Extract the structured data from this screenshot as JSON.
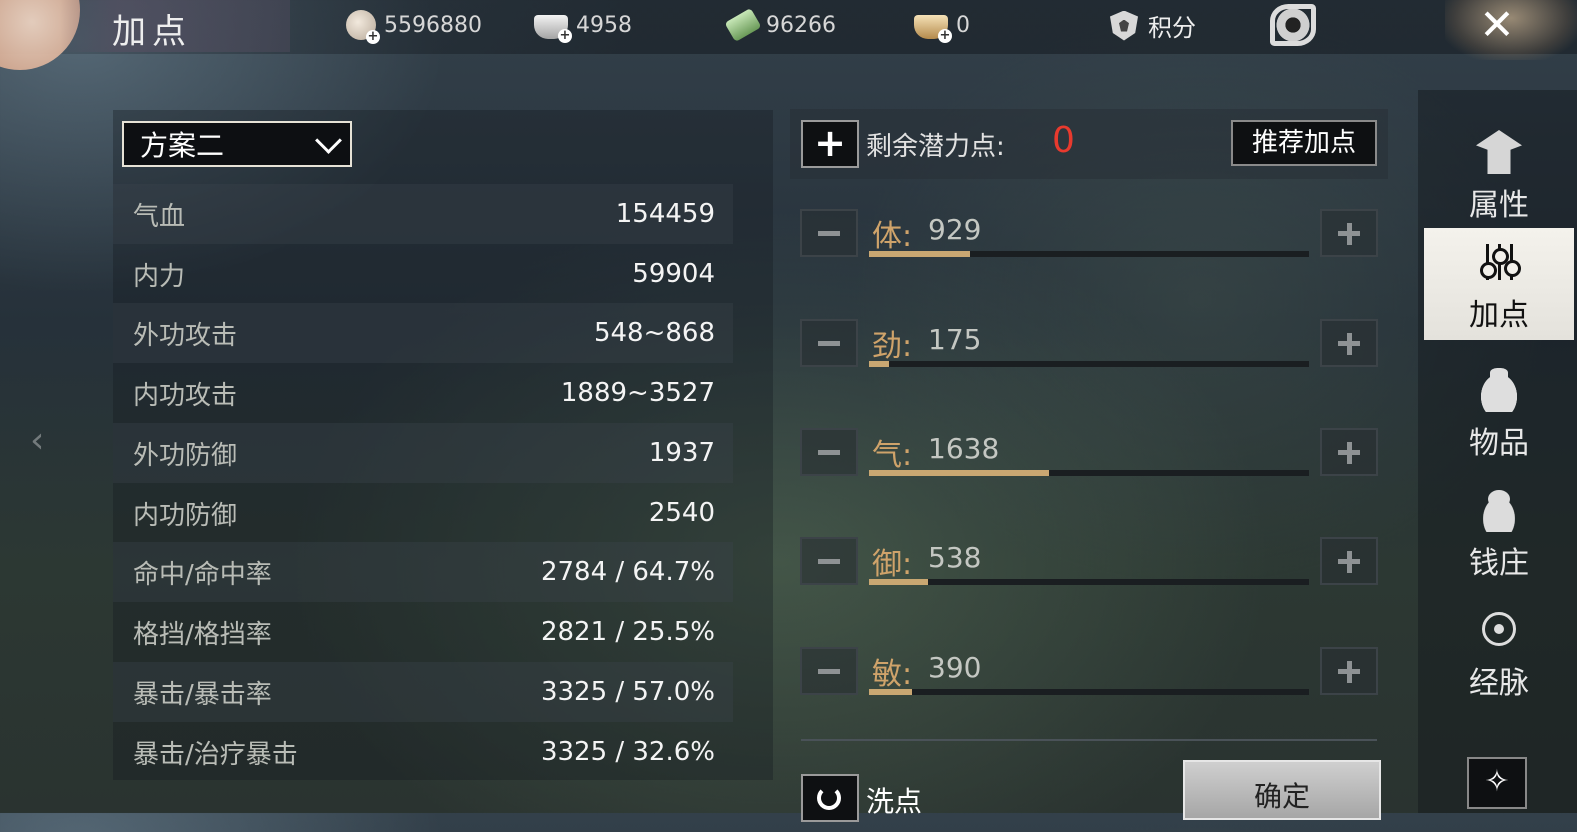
{
  "header": {
    "title": "加点",
    "currencies": [
      {
        "icon": "coin-plus-icon",
        "value": "5596880"
      },
      {
        "icon": "silver-ingot-plus-icon",
        "value": "4958"
      },
      {
        "icon": "jade-plus-icon",
        "value": "96266"
      },
      {
        "icon": "gold-ingot-plus-icon",
        "value": "0"
      }
    ],
    "score_label": "积分"
  },
  "plan": {
    "selected": "方案二"
  },
  "stats": [
    {
      "name": "气血",
      "value": "154459"
    },
    {
      "name": "内力",
      "value": "59904"
    },
    {
      "name": "外功攻击",
      "value": "548~868"
    },
    {
      "name": "内功攻击",
      "value": "1889~3527"
    },
    {
      "name": "外功防御",
      "value": "1937"
    },
    {
      "name": "内功防御",
      "value": "2540"
    },
    {
      "name": "命中/命中率",
      "value": "2784 / 64.7%"
    },
    {
      "name": "格挡/格挡率",
      "value": "2821 / 25.5%"
    },
    {
      "name": "暴击/暴击率",
      "value": "3325 / 57.0%"
    },
    {
      "name": "暴击/治疗暴击",
      "value": "3325 / 32.6%"
    }
  ],
  "allocation": {
    "remaining_label": "剩余潜力点:",
    "remaining_value": "0",
    "recommend_label": "推荐加点",
    "attributes": [
      {
        "name": "体:",
        "value": "929",
        "fill": 0.23
      },
      {
        "name": "劲:",
        "value": "175",
        "fill": 0.045
      },
      {
        "name": "气:",
        "value": "1638",
        "fill": 0.41
      },
      {
        "name": "御:",
        "value": "538",
        "fill": 0.135
      },
      {
        "name": "敏:",
        "value": "390",
        "fill": 0.098
      }
    ],
    "reset_label": "洗点",
    "confirm_label": "确定"
  },
  "sidebar": {
    "items": [
      {
        "label": "属性",
        "icon": "hat-icon"
      },
      {
        "label": "加点",
        "icon": "sliders-icon",
        "active": true
      },
      {
        "label": "物品",
        "icon": "bag-icon"
      },
      {
        "label": "钱庄",
        "icon": "money-bag-icon"
      },
      {
        "label": "经脉",
        "icon": "meridian-icon"
      }
    ]
  },
  "colors": {
    "accent": "#cfa36a",
    "alert": "#e83a2e",
    "bar_fill": "#c9a772"
  }
}
